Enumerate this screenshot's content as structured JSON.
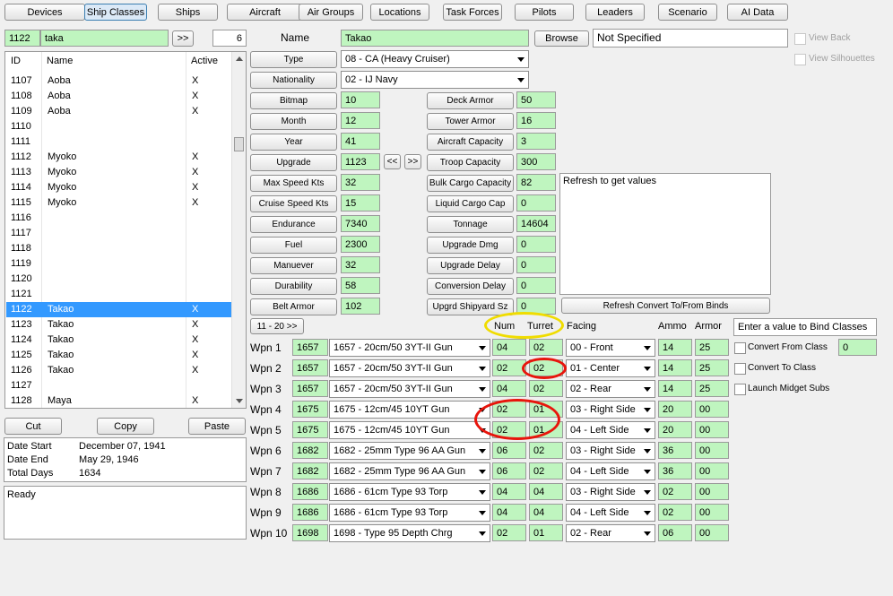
{
  "toolbar": [
    "Devices",
    "Ship Classes",
    "Ships",
    "Aircraft",
    "Air Groups",
    "Locations",
    "Task Forces",
    "Pilots",
    "Leaders",
    "Scenario",
    "AI Data"
  ],
  "search": {
    "id": "1122",
    "text": "taka",
    "go_label": ">>",
    "count": "6"
  },
  "list": {
    "headers": {
      "id": "ID",
      "name": "Name",
      "active": "Active"
    },
    "rows": [
      {
        "id": "1107",
        "name": "Aoba",
        "active": "X"
      },
      {
        "id": "1108",
        "name": "Aoba",
        "active": "X"
      },
      {
        "id": "1109",
        "name": "Aoba",
        "active": "X"
      },
      {
        "id": "1110",
        "name": "",
        "active": ""
      },
      {
        "id": "1111",
        "name": "",
        "active": ""
      },
      {
        "id": "1112",
        "name": "Myoko",
        "active": "X"
      },
      {
        "id": "1113",
        "name": "Myoko",
        "active": "X"
      },
      {
        "id": "1114",
        "name": "Myoko",
        "active": "X"
      },
      {
        "id": "1115",
        "name": "Myoko",
        "active": "X"
      },
      {
        "id": "1116",
        "name": "",
        "active": ""
      },
      {
        "id": "1117",
        "name": "",
        "active": ""
      },
      {
        "id": "1118",
        "name": "",
        "active": ""
      },
      {
        "id": "1119",
        "name": "",
        "active": ""
      },
      {
        "id": "1120",
        "name": "",
        "active": ""
      },
      {
        "id": "1121",
        "name": "",
        "active": ""
      },
      {
        "id": "1122",
        "name": "Takao",
        "active": "X"
      },
      {
        "id": "1123",
        "name": "Takao",
        "active": "X"
      },
      {
        "id": "1124",
        "name": "Takao",
        "active": "X"
      },
      {
        "id": "1125",
        "name": "Takao",
        "active": "X"
      },
      {
        "id": "1126",
        "name": "Takao",
        "active": "X"
      },
      {
        "id": "1127",
        "name": "",
        "active": ""
      },
      {
        "id": "1128",
        "name": "Maya",
        "active": "X"
      }
    ],
    "selected_index": 15
  },
  "clip": {
    "cut": "Cut",
    "copy": "Copy",
    "paste": "Paste"
  },
  "dates": {
    "start_label": "Date Start",
    "start": "December 07, 1941",
    "end_label": "Date End",
    "end": "May 29, 1946",
    "total_label": "Total Days",
    "total": "1634"
  },
  "status": "Ready",
  "name_label": "Name",
  "name_value": "Takao",
  "browse_label": "Browse",
  "bitmap_file": "Not Specified",
  "view_back": "View Back",
  "view_silhouettes": "View Silhouettes",
  "type_label": "Type",
  "type_value": "08 - CA (Heavy Cruiser)",
  "nationality_label": "Nationality",
  "nationality_value": "02 - IJ Navy",
  "left_fields": [
    {
      "label": "Bitmap",
      "value": "10"
    },
    {
      "label": "Month",
      "value": "12"
    },
    {
      "label": "Year",
      "value": "41"
    },
    {
      "label": "Upgrade",
      "value": "1123"
    },
    {
      "label": "Max Speed Kts",
      "value": "32"
    },
    {
      "label": "Cruise Speed Kts",
      "value": "15"
    },
    {
      "label": "Endurance",
      "value": "7340"
    },
    {
      "label": "Fuel",
      "value": "2300"
    },
    {
      "label": "Manuever",
      "value": "32"
    },
    {
      "label": "Durability",
      "value": "58"
    },
    {
      "label": "Belt Armor",
      "value": "102"
    }
  ],
  "upgrade_prev": "<<",
  "upgrade_next": ">>",
  "right_fields": [
    {
      "label": "Deck Armor",
      "value": "50"
    },
    {
      "label": "Tower Armor",
      "value": "16"
    },
    {
      "label": "Aircraft Capacity",
      "value": "3"
    },
    {
      "label": "Troop Capacity",
      "value": "300"
    },
    {
      "label": "Bulk Cargo Capacity",
      "value": "82"
    },
    {
      "label": "Liquid Cargo Cap",
      "value": "0"
    },
    {
      "label": "Tonnage",
      "value": "14604"
    },
    {
      "label": "Upgrade Dmg",
      "value": "0"
    },
    {
      "label": "Upgrade Delay",
      "value": "0"
    },
    {
      "label": "Conversion Delay",
      "value": "0"
    },
    {
      "label": "Upgrd Shipyard Sz",
      "value": "0"
    }
  ],
  "convert_text": "Refresh to get values",
  "refresh_label": "Refresh Convert To/From Binds",
  "page_button": "11 - 20  >>",
  "weapon_headers": {
    "num": "Num",
    "turret": "Turret",
    "facing": "Facing",
    "ammo": "Ammo",
    "armor": "Armor"
  },
  "weapons": [
    {
      "label": "Wpn 1",
      "id": "1657",
      "device": "1657 - 20cm/50 3YT-II Gun",
      "num": "04",
      "turret": "02",
      "facing": "00 - Front",
      "ammo": "14",
      "armor": "25"
    },
    {
      "label": "Wpn 2",
      "id": "1657",
      "device": "1657 - 20cm/50 3YT-II Gun",
      "num": "02",
      "turret": "02",
      "facing": "01 - Center",
      "ammo": "14",
      "armor": "25"
    },
    {
      "label": "Wpn 3",
      "id": "1657",
      "device": "1657 - 20cm/50 3YT-II Gun",
      "num": "04",
      "turret": "02",
      "facing": "02 - Rear",
      "ammo": "14",
      "armor": "25"
    },
    {
      "label": "Wpn 4",
      "id": "1675",
      "device": "1675 - 12cm/45 10YT Gun",
      "num": "02",
      "turret": "01",
      "facing": "03 - Right Side",
      "ammo": "20",
      "armor": "00"
    },
    {
      "label": "Wpn 5",
      "id": "1675",
      "device": "1675 - 12cm/45 10YT Gun",
      "num": "02",
      "turret": "01",
      "facing": "04 - Left Side",
      "ammo": "20",
      "armor": "00"
    },
    {
      "label": "Wpn 6",
      "id": "1682",
      "device": "1682 - 25mm Type 96 AA Gun",
      "num": "06",
      "turret": "02",
      "facing": "03 - Right Side",
      "ammo": "36",
      "armor": "00"
    },
    {
      "label": "Wpn 7",
      "id": "1682",
      "device": "1682 - 25mm Type 96 AA Gun",
      "num": "06",
      "turret": "02",
      "facing": "04 - Left Side",
      "ammo": "36",
      "armor": "00"
    },
    {
      "label": "Wpn 8",
      "id": "1686",
      "device": "1686 - 61cm Type 93 Torp",
      "num": "04",
      "turret": "04",
      "facing": "03 - Right Side",
      "ammo": "02",
      "armor": "00"
    },
    {
      "label": "Wpn 9",
      "id": "1686",
      "device": "1686 - 61cm Type 93 Torp",
      "num": "04",
      "turret": "04",
      "facing": "04 - Left Side",
      "ammo": "02",
      "armor": "00"
    },
    {
      "label": "Wpn 10",
      "id": "1698",
      "device": "1698 - Type 95 Depth Chrg",
      "num": "02",
      "turret": "01",
      "facing": "02 - Rear",
      "ammo": "06",
      "armor": "00"
    }
  ],
  "bind_hint": "Enter a value to Bind Classes",
  "convert_from": "Convert From Class",
  "convert_from_value": "0",
  "convert_to": "Convert To Class",
  "launch_midget": "Launch Midget Subs",
  "colors": {
    "field_green": "#bff5bf",
    "selection": "#3399ff",
    "red_mark": "#e8150c",
    "yellow_mark": "#f0dc00"
  }
}
